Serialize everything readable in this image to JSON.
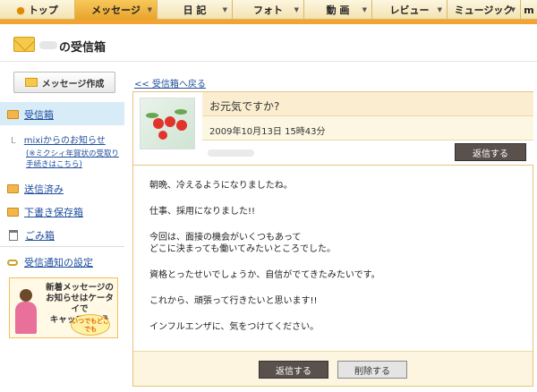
{
  "nav": {
    "items": [
      {
        "label": "トップ",
        "active": false
      },
      {
        "label": "メッセージ",
        "active": true
      },
      {
        "label": "日 記",
        "active": false
      },
      {
        "label": "フォト",
        "active": false
      },
      {
        "label": "動 画",
        "active": false
      },
      {
        "label": "レビュー",
        "active": false
      },
      {
        "label": "ミュージック",
        "active": false
      },
      {
        "label": "m",
        "active": false
      }
    ]
  },
  "page": {
    "title": "の受信箱"
  },
  "sidebar": {
    "compose_label": "メッセージ作成",
    "inbox_label": "受信箱",
    "sub_item_label": "mixiからのお知らせ",
    "sub_item_note": "(※ミクシィ年賀状の受取り手続きはこちら)",
    "sent_label": "送信済み",
    "drafts_label": "下書き保存箱",
    "trash_label": "ごみ箱",
    "notification_label": "受信通知の設定",
    "banner": {
      "line1": "新着メッセージの",
      "line2": "お知らせはケータイで",
      "line3": "キャッチしよう",
      "bubble": "いつでもどこでも"
    }
  },
  "main": {
    "back_link": "<< 受信箱へ戻る",
    "subject": "お元気ですか?",
    "date": "2009年10月13日 15時43分",
    "reply_label": "返信する",
    "delete_label": "削除する",
    "body": [
      "朝晩、冷えるようになりましたね。",
      "",
      "仕事、採用になりました!!",
      "",
      "今回は、面接の機会がいくつもあって",
      "どこに決まっても働いてみたいところでした。",
      "",
      "資格とったせいでしょうか、自信がでてきたみたいです。",
      "",
      "これから、頑張って行きたいと思います!!",
      "",
      "インフルエンザに、気をつけてください。"
    ]
  }
}
